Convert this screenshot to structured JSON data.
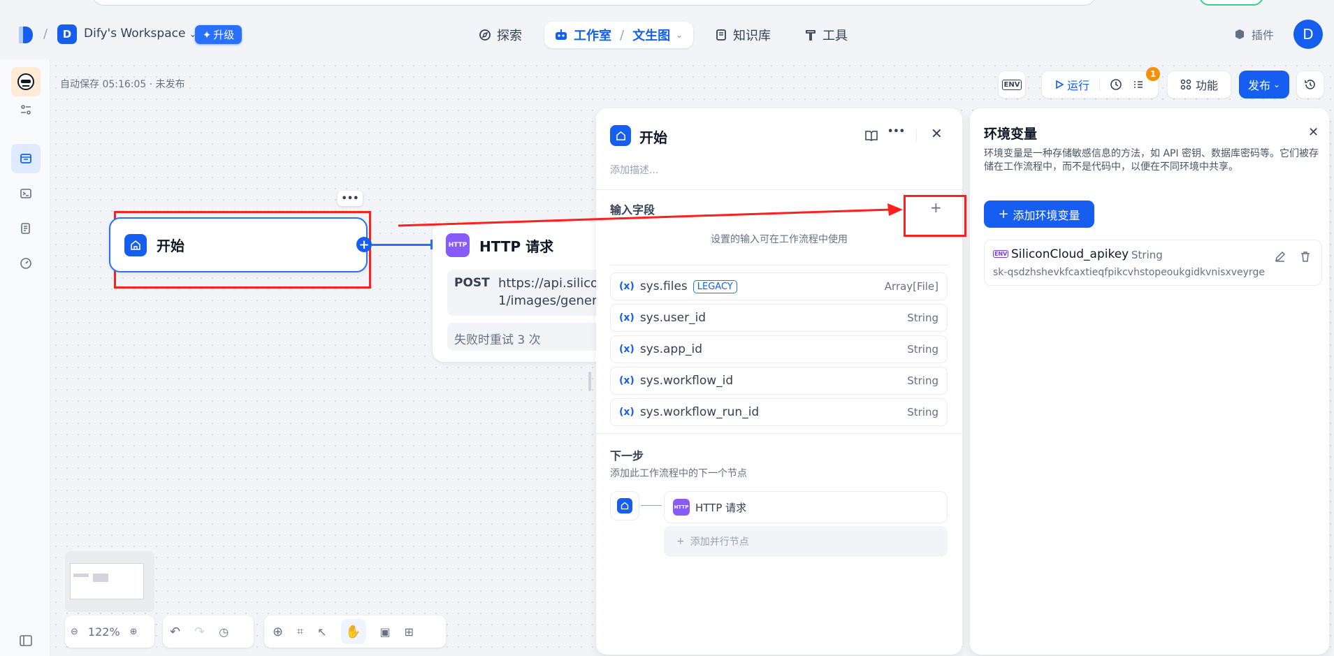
{
  "workspace": {
    "initial": "D",
    "name": "Dify's Workspace",
    "upgrade_label": "升级"
  },
  "nav": {
    "explore": "探索",
    "studio": "工作室",
    "app_name": "文生图",
    "knowledge": "知识库",
    "tools": "工具",
    "plugins": "插件",
    "user_initial": "D"
  },
  "canvas": {
    "autosave": "自动保存 05:16:05 · 未发布"
  },
  "toolbar": {
    "run": "运行",
    "features": "功能",
    "publish": "发布",
    "checklist_count": "1",
    "env_icon": "ENV"
  },
  "start_node": {
    "title": "开始"
  },
  "http_node": {
    "icon": "HTTP",
    "title": "HTTP 请求",
    "method": "POST",
    "url_line1": "https://api.silico",
    "url_line2": "1/images/gener",
    "retry": "失败时重试 3 次"
  },
  "start_panel": {
    "title": "开始",
    "desc_placeholder": "添加描述...",
    "input_section": "输入字段",
    "input_hint": "设置的输入可在工作流程中使用",
    "legacy_badge": "LEGACY",
    "fields": [
      {
        "name": "sys.files",
        "type": "Array[File]",
        "legacy": true
      },
      {
        "name": "sys.user_id",
        "type": "String"
      },
      {
        "name": "sys.app_id",
        "type": "String"
      },
      {
        "name": "sys.workflow_id",
        "type": "String"
      },
      {
        "name": "sys.workflow_run_id",
        "type": "String"
      }
    ],
    "next_title": "下一步",
    "next_desc": "添加此工作流程中的下一个节点",
    "next_node_icon": "HTTP",
    "next_node": "HTTP 请求",
    "add_parallel": "添加并行节点"
  },
  "env_panel": {
    "title": "环境变量",
    "desc": "环境变量是一种存储敏感信息的方法，如 API 密钥、数据库密码等。它们被存储在工作流程中，而不是代码中，以便在不同环境中共享。",
    "add_button": "添加环境变量",
    "variable": {
      "name": "SiliconCloud_apikey",
      "type": "String",
      "value": "sk-qsdzhshevkfcaxtieqfpikcvhstopeoukgidkvnisxveyrge"
    }
  },
  "zoom": {
    "level": "122%"
  },
  "colors": {
    "accent": "#155eef",
    "annotation": "#ff1f1f",
    "http_purple": "#875bf7"
  }
}
